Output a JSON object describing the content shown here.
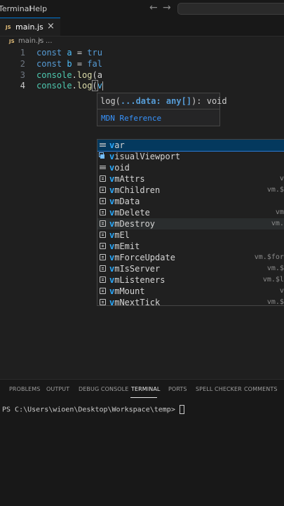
{
  "menu": {
    "terminal": "Terminal",
    "help": "Help"
  },
  "nav": {
    "back": "←",
    "forward": "→"
  },
  "tab": {
    "badge": "JS",
    "filename": "main.js",
    "close": "×"
  },
  "breadcrumb": {
    "badge": "JS",
    "file": "main.js",
    "sep": "›",
    "rest": "..."
  },
  "editor": {
    "lines": [
      {
        "number": "1"
      },
      {
        "number": "2"
      },
      {
        "number": "3"
      },
      {
        "number": "4"
      }
    ],
    "l1": {
      "kw": "const",
      "name": "a",
      "op": "=",
      "val": "tru"
    },
    "l2": {
      "kw": "const",
      "name": "b",
      "op": "=",
      "val": "fal"
    },
    "l3": {
      "obj": "console",
      "dot": ".",
      "fn": "log",
      "rest": "(a"
    },
    "l4": {
      "obj": "console",
      "dot": ".",
      "fn": "log",
      "paren": "(",
      "typed": "v"
    }
  },
  "signature_help": {
    "prefix": "log(",
    "param": "...data: any[]",
    "suffix": "): void",
    "doc_link": "MDN Reference"
  },
  "suggest": {
    "items": [
      {
        "match": "v",
        "rest": "ar",
        "detail": ""
      },
      {
        "match": "v",
        "rest": "isualViewport",
        "detail": ""
      },
      {
        "match": "v",
        "rest": "oid",
        "detail": ""
      },
      {
        "match": "v",
        "rest": "mAttrs",
        "detail": "vm.$a"
      },
      {
        "match": "v",
        "rest": "mChildren",
        "detail": "vm.$chil"
      },
      {
        "match": "v",
        "rest": "mData",
        "detail": "vm.$"
      },
      {
        "match": "v",
        "rest": "mDelete",
        "detail": "vm.$de"
      },
      {
        "match": "v",
        "rest": "mDestroy",
        "detail": "vm.$des"
      },
      {
        "match": "v",
        "rest": "mEl",
        "detail": "vm"
      },
      {
        "match": "v",
        "rest": "mEmit",
        "detail": "vm.$"
      },
      {
        "match": "v",
        "rest": "mForceUpdate",
        "detail": "vm.$forceUp"
      },
      {
        "match": "v",
        "rest": "mIsServer",
        "detail": "vm.$isSe"
      },
      {
        "match": "v",
        "rest": "mListeners",
        "detail": "vm.$liste"
      },
      {
        "match": "v",
        "rest": "mMount",
        "detail": "vm.$m"
      },
      {
        "match": "v",
        "rest": "mNextTick",
        "detail": "vm.$next"
      }
    ]
  },
  "panel": {
    "tabs": [
      "PROBLEMS",
      "OUTPUT",
      "DEBUG CONSOLE",
      "TERMINAL",
      "PORTS",
      "SPELL CHECKER",
      "COMMENTS"
    ],
    "terminal_prompt": "PS C:\\Users\\wioen\\Desktop\\Workspace\\temp> "
  },
  "colors": {
    "accent": "#0078d4",
    "selection": "#04395e",
    "match": "#2aaaff"
  }
}
